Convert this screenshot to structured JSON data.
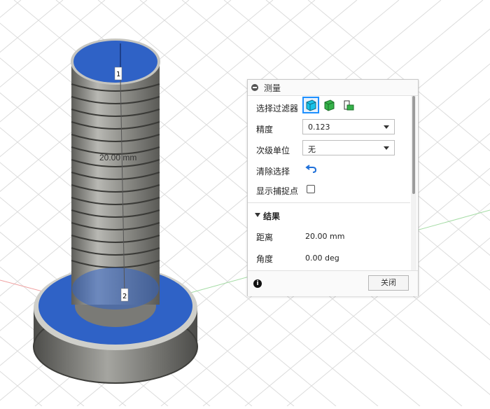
{
  "viewport": {
    "dimension_label": "20.00 mm",
    "marker_1": "1",
    "marker_2": "2",
    "selection_color": "#2f62c6",
    "part_color": "#8b8b86"
  },
  "measure_panel": {
    "title": "测量",
    "selection_filter_label": "选择过滤器",
    "filter_icons": [
      "face-filter-icon",
      "body-filter-icon",
      "component-filter-icon"
    ],
    "precision_label": "精度",
    "precision_value": "0.123",
    "secondary_units_label": "次级单位",
    "secondary_units_value": "无",
    "clear_selection_label": "清除选择",
    "show_snap_points_label": "显示捕捉点",
    "show_snap_points_checked": false,
    "results_title": "结果",
    "distance_label": "距离",
    "distance_value": "20.00 mm",
    "angle_label": "角度",
    "angle_value": "0.00 deg",
    "close_label": "关闭"
  }
}
